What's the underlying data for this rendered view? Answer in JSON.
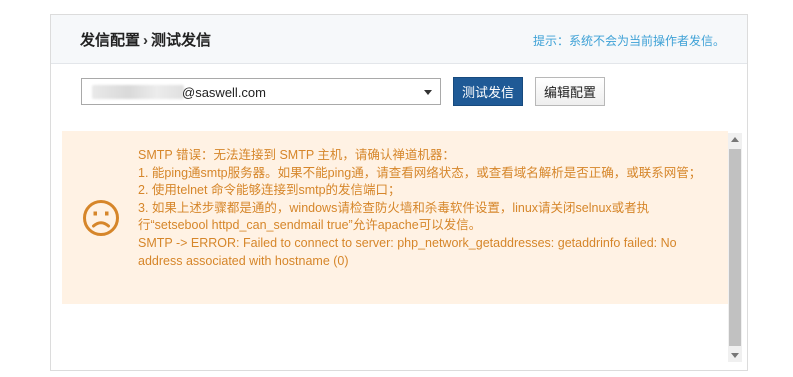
{
  "header": {
    "breadcrumb_parent": "发信配置",
    "breadcrumb_sep": "›",
    "breadcrumb_current": "测试发信",
    "hint": "提示：系统不会为当前操作者发信。"
  },
  "form": {
    "sender_value": "@saswell.com",
    "test_button": "测试发信",
    "edit_button": "编辑配置"
  },
  "error": {
    "icon": "sad-face-icon",
    "lines": [
      "SMTP 错误：无法连接到 SMTP 主机，请确认禅道机器：",
      "1. 能ping通smtp服务器。如果不能ping通，请查看网络状态，或查看域名解析是否正确，或联系网管；",
      "2. 使用telnet 命令能够连接到smtp的发信端口；",
      "3. 如果上述步骤都是通的，windows请检查防火墙和杀毒软件设置，linux请关闭selnux或者执行“setsebool httpd_can_sendmail true”允许apache可以发信。",
      "SMTP -> ERROR: Failed to connect to server: php_network_getaddresses: getaddrinfo failed: No address associated with hostname (0)"
    ]
  },
  "colors": {
    "accent": "#1f5a96",
    "hint": "#3ea1d6",
    "error_text": "#d6862a",
    "error_bg": "#fff2e4"
  }
}
